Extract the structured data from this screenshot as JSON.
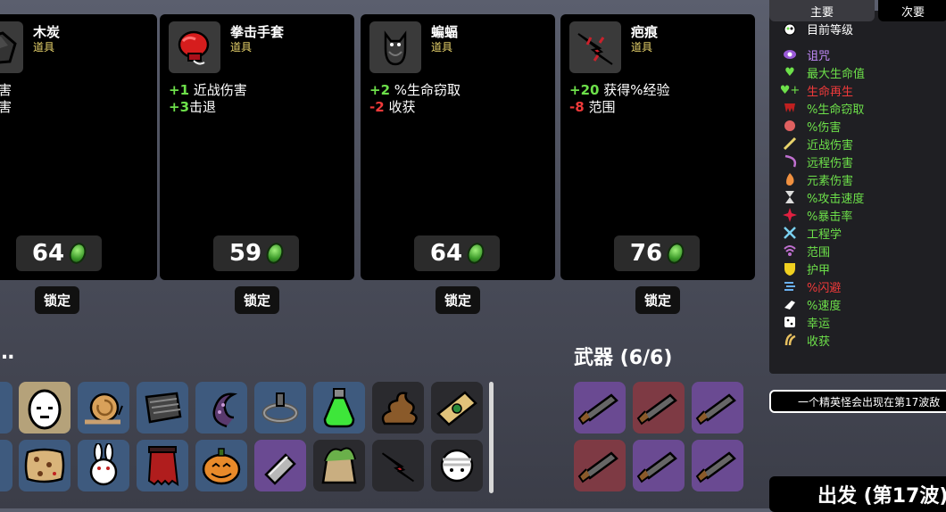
{
  "shop": {
    "cards": [
      {
        "name": "木炭",
        "type": "道具",
        "stats": [
          {
            "num": "",
            "text": "素伤害"
          },
          {
            "num": "",
            "text": "战伤害"
          },
          {
            "num": "",
            "text": "获"
          }
        ],
        "price": "64",
        "lock_label": "锁定",
        "icon": "charcoal-icon"
      },
      {
        "name": "拳击手套",
        "type": "道具",
        "stats": [
          {
            "num": "+1",
            "text": " 近战伤害",
            "sign": "pos"
          },
          {
            "num": "+3",
            "text": "击退",
            "sign": "pos"
          }
        ],
        "price": "59",
        "lock_label": "锁定",
        "icon": "boxing-glove-icon"
      },
      {
        "name": "蝙蝠",
        "type": "道具",
        "stats": [
          {
            "num": "+2",
            "text": " %生命窃取",
            "sign": "pos"
          },
          {
            "num": "-2",
            "text": " 收获",
            "sign": "neg"
          }
        ],
        "price": "64",
        "lock_label": "锁定",
        "icon": "bat-icon"
      },
      {
        "name": "疤痕",
        "type": "道具",
        "stats": [
          {
            "num": "+20",
            "text": " 获得%经验",
            "sign": "pos"
          },
          {
            "num": "-8",
            "text": " 范围",
            "sign": "neg"
          }
        ],
        "price": "76",
        "lock_label": "锁定",
        "icon": "scar-icon"
      }
    ]
  },
  "inventory": {
    "title_fragment": "…",
    "row1": [
      {
        "icon": "partial-item-icon",
        "bg": "blue"
      },
      {
        "icon": "egg-face-icon",
        "bg": "tan"
      },
      {
        "icon": "snail-icon",
        "bg": "blue"
      },
      {
        "icon": "armor-plate-icon",
        "bg": "blue"
      },
      {
        "icon": "tentacle-icon",
        "bg": "blue"
      },
      {
        "icon": "chain-shackle-icon",
        "bg": "blue"
      },
      {
        "icon": "green-potion-icon",
        "bg": "blue"
      },
      {
        "icon": "poop-icon",
        "bg": "dark"
      },
      {
        "icon": "treasure-map-icon",
        "bg": "dark"
      }
    ],
    "row2": [
      {
        "icon": "partial-item-icon",
        "bg": "blue"
      },
      {
        "icon": "leopard-pelt-icon",
        "bg": "blue"
      },
      {
        "icon": "rabbit-icon",
        "bg": "blue"
      },
      {
        "icon": "red-cape-icon",
        "bg": "blue"
      },
      {
        "icon": "pumpkin-icon",
        "bg": "blue"
      },
      {
        "icon": "metal-bar-icon",
        "bg": "purple"
      },
      {
        "icon": "fertilizer-bag-icon",
        "bg": "dark"
      },
      {
        "icon": "scar-icon",
        "bg": "dark"
      },
      {
        "icon": "bandaged-head-icon",
        "bg": "dark"
      }
    ]
  },
  "weapons": {
    "title": "武器 (6/6)",
    "slots": [
      {
        "icon": "shotgun-icon",
        "bg": "purple"
      },
      {
        "icon": "shotgun-icon",
        "bg": "red"
      },
      {
        "icon": "shotgun-icon",
        "bg": "purple"
      },
      {
        "icon": "shotgun-icon",
        "bg": "red"
      },
      {
        "icon": "shotgun-icon",
        "bg": "purple"
      },
      {
        "icon": "shotgun-icon",
        "bg": "purple"
      }
    ]
  },
  "stats_panel": {
    "tabs": [
      "主要",
      "次要"
    ],
    "rows": [
      {
        "label": "目前等级",
        "color": "#ffffff",
        "icon": "level-icon"
      },
      {
        "label": "诅咒",
        "color": "#c58cff",
        "icon": "curse-eye-icon"
      },
      {
        "label": "最大生命值",
        "color": "#6de04a",
        "icon": "heart-icon"
      },
      {
        "label": "生命再生",
        "color": "#f03a3a",
        "icon": "regen-heart-icon"
      },
      {
        "label": "%生命窃取",
        "color": "#6de04a",
        "icon": "fang-icon"
      },
      {
        "label": "%伤害",
        "color": "#6de04a",
        "icon": "muscle-icon"
      },
      {
        "label": "近战伤害",
        "color": "#6de04a",
        "icon": "sword-icon"
      },
      {
        "label": "远程伤害",
        "color": "#6de04a",
        "icon": "bow-icon"
      },
      {
        "label": "元素伤害",
        "color": "#6de04a",
        "icon": "flame-icon"
      },
      {
        "label": "%攻击速度",
        "color": "#6de04a",
        "icon": "hourglass-icon"
      },
      {
        "label": "%暴击率",
        "color": "#6de04a",
        "icon": "crit-icon"
      },
      {
        "label": "工程学",
        "color": "#6de04a",
        "icon": "wrench-icon"
      },
      {
        "label": "范围",
        "color": "#6de04a",
        "icon": "range-icon"
      },
      {
        "label": "护甲",
        "color": "#6de04a",
        "icon": "shield-icon"
      },
      {
        "label": "%闪避",
        "color": "#f03a3a",
        "icon": "dodge-icon"
      },
      {
        "label": "%速度",
        "color": "#6de04a",
        "icon": "speed-icon"
      },
      {
        "label": "幸运",
        "color": "#6de04a",
        "icon": "dice-icon"
      },
      {
        "label": "收获",
        "color": "#6de04a",
        "icon": "harvest-icon"
      }
    ]
  },
  "banner": {
    "text": "一个精英怪会出现在第17波敌"
  },
  "go_button": {
    "label": "出发 (第17波)"
  }
}
